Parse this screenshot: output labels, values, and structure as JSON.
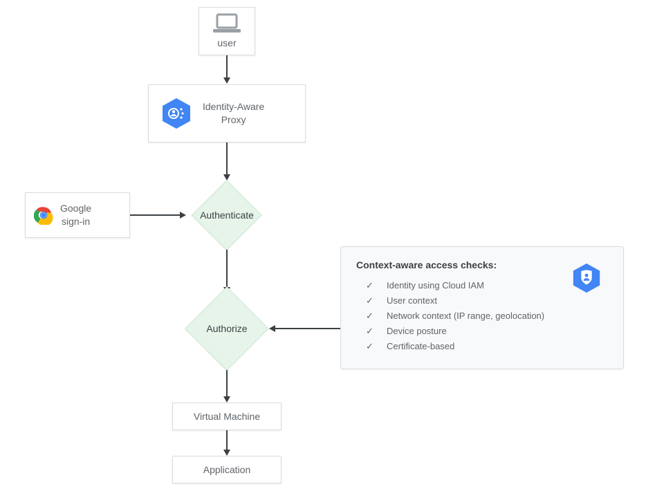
{
  "nodes": {
    "user": {
      "label": "user"
    },
    "iap": {
      "line1": "Identity-Aware",
      "line2": "Proxy"
    },
    "signin": {
      "line1": "Google",
      "line2": "sign-in"
    },
    "authenticate": {
      "label": "Authenticate"
    },
    "authorize": {
      "label": "Authorize"
    },
    "vm": {
      "label": "Virtual Machine"
    },
    "app": {
      "label": "Application"
    }
  },
  "context": {
    "title": "Context-aware access checks:",
    "items": [
      "Identity using Cloud IAM",
      "User context",
      "Network context (IP range, geolocation)",
      "Device posture",
      "Certificate-based"
    ]
  }
}
